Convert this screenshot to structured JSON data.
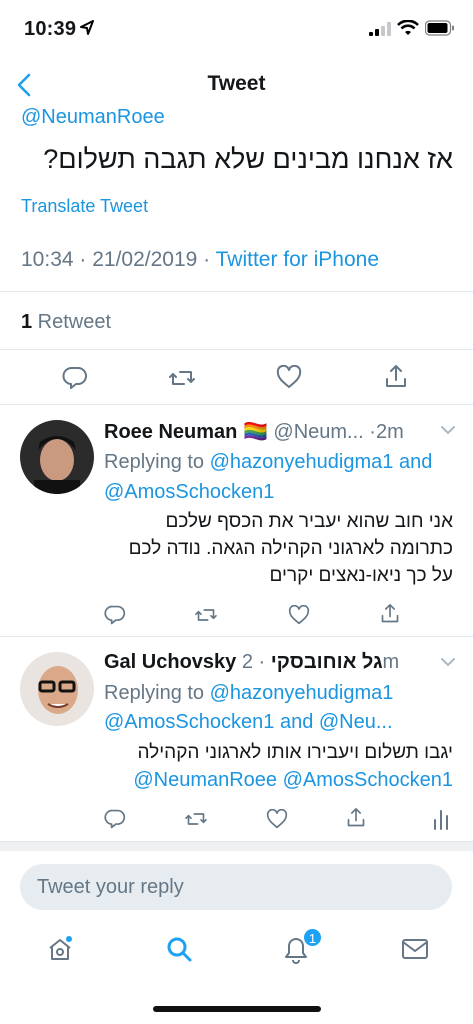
{
  "status_bar": {
    "time": "10:39"
  },
  "nav": {
    "title": "Tweet"
  },
  "main_tweet": {
    "handle": "@NeumanRoee",
    "text": "אז אנחנו מבינים שלא תגבה תשלום?",
    "translate": "Translate Tweet",
    "timestamp": "10:34 · 21/02/2019 · ",
    "source": "Twitter for iPhone",
    "retweet_count": "1",
    "retweet_label": " Retweet"
  },
  "replies": [
    {
      "name": "Roee Neuman",
      "flag": "🏳️‍🌈",
      "handle": "@Neum...",
      "time": "·2m",
      "replying_to_label": "Replying to ",
      "replying_line1_mention": "@hazonyehudigma1",
      "replying_line1_suffix": " and",
      "replying_line2": "@AmosSchocken1",
      "text_lines": [
        "אני חוב שהוא יעביר את הכסף שלכם",
        "כתרומה לארגוני הקהילה הגאה. נודה לכם",
        "על כך ניאו-נאצים יקרים"
      ]
    },
    {
      "name": "Gal Uchovsky",
      "name_hebrew": "גל אוחובסקי",
      "time": "· 2m",
      "replying_to_label": "Replying to ",
      "replying_line1_mention": "@hazonyehudigma1",
      "replying_line2_a": "@AmosSchocken1",
      "replying_line2_and": " and ",
      "replying_line2_b": "@Neu...",
      "text_line1": "יגבו תשלום ויעבירו אותו לארגוני הקהילה",
      "text_line2_mentions": "@NeumanRoee @AmosSchocken1"
    }
  ],
  "composer": {
    "placeholder": "Tweet your reply"
  },
  "tabbar": {
    "notification_badge": "1"
  },
  "colors": {
    "accent": "#1b95e0",
    "secondary_text": "#657786",
    "divider": "#e1e8ed"
  }
}
